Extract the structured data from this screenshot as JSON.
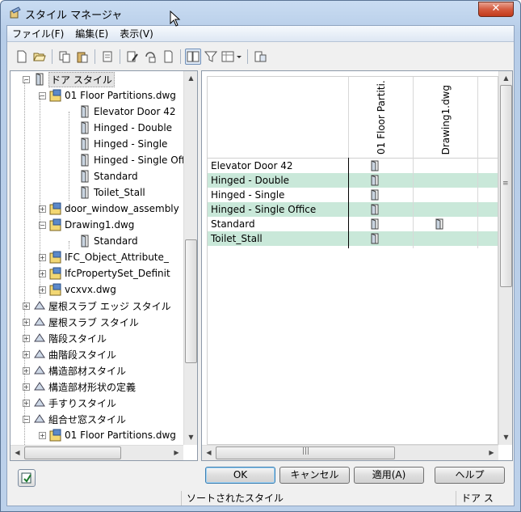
{
  "window": {
    "title": "スタイル マネージャ",
    "close_label": "✕"
  },
  "menu": [
    {
      "label": "ファイル(F)"
    },
    {
      "label": "編集(E)"
    },
    {
      "label": "表示(V)"
    }
  ],
  "toolbar": {
    "icons": [
      "new-icon",
      "open-icon",
      "copy-icon",
      "paste-icon",
      "purge-icon",
      "edit-icon",
      "set-from-icon",
      "toggle-view-icon",
      "filter-icon",
      "view-options-icon",
      "sort-icon"
    ]
  },
  "tree": {
    "rows": [
      {
        "label": "ドア スタイル",
        "level": 0,
        "expander": "−",
        "icon": "door-icon",
        "selected": true
      },
      {
        "label": "01 Floor Partitions.dwg",
        "level": 1,
        "expander": "−",
        "icon": "drawing-file-icon"
      },
      {
        "label": "Elevator Door 42",
        "level": 2,
        "icon": "door-style-icon"
      },
      {
        "label": "Hinged - Double",
        "level": 2,
        "icon": "door-style-icon"
      },
      {
        "label": "Hinged - Single",
        "level": 2,
        "icon": "door-style-icon"
      },
      {
        "label": "Hinged - Single Office",
        "level": 2,
        "icon": "door-style-icon"
      },
      {
        "label": "Standard",
        "level": 2,
        "icon": "door-style-icon"
      },
      {
        "label": "Toilet_Stall",
        "level": 2,
        "icon": "door-style-icon"
      },
      {
        "label": "door_window_assembly",
        "level": 1,
        "expander": "+",
        "icon": "drawing-file-icon"
      },
      {
        "label": "Drawing1.dwg",
        "level": 1,
        "expander": "−",
        "icon": "drawing-file-icon"
      },
      {
        "label": "Standard",
        "level": 2,
        "icon": "door-style-icon"
      },
      {
        "label": "IFC_Object_Attribute_",
        "level": 1,
        "expander": "+",
        "icon": "drawing-file-icon"
      },
      {
        "label": "IfcPropertySet_Definit",
        "level": 1,
        "expander": "+",
        "icon": "drawing-file-icon"
      },
      {
        "label": "vcxvx.dwg",
        "level": 1,
        "expander": "+",
        "icon": "drawing-file-icon"
      },
      {
        "label": "屋根スラブ エッジ スタイル",
        "level": 0,
        "expander": "+",
        "icon": "roof-edge-icon"
      },
      {
        "label": "屋根スラブ スタイル",
        "level": 0,
        "expander": "+",
        "icon": "roof-slab-icon"
      },
      {
        "label": "階段スタイル",
        "level": 0,
        "expander": "+",
        "icon": "stair-icon"
      },
      {
        "label": "曲階段スタイル",
        "level": 0,
        "expander": "+",
        "icon": "curved-stair-icon"
      },
      {
        "label": "構造部材スタイル",
        "level": 0,
        "expander": "+",
        "icon": "structural-member-icon"
      },
      {
        "label": "構造部材形状の定義",
        "level": 0,
        "expander": "+",
        "icon": "structural-shape-icon"
      },
      {
        "label": "手すりスタイル",
        "level": 0,
        "expander": "+",
        "icon": "railing-icon"
      },
      {
        "label": "組合せ窓スタイル",
        "level": 0,
        "expander": "−",
        "icon": "window-assembly-icon"
      },
      {
        "label": "01 Floor Partitions.dwg",
        "level": 1,
        "expander": "+",
        "icon": "drawing-file-icon"
      }
    ]
  },
  "grid": {
    "columns": [
      {
        "label": "01 Floor Partiti..."
      },
      {
        "label": "Drawing1.dwg"
      },
      {
        "label": ""
      }
    ],
    "rows": [
      {
        "label": "Elevator Door 42",
        "cells": [
          true,
          false,
          false
        ]
      },
      {
        "label": "Hinged - Double",
        "cells": [
          true,
          false,
          false
        ]
      },
      {
        "label": "Hinged - Single",
        "cells": [
          true,
          false,
          false
        ]
      },
      {
        "label": "Hinged - Single Office",
        "cells": [
          true,
          false,
          false
        ]
      },
      {
        "label": "Standard",
        "cells": [
          true,
          true,
          false
        ]
      },
      {
        "label": "Toilet_Stall",
        "cells": [
          true,
          false,
          false
        ]
      }
    ]
  },
  "buttons": {
    "ok": "OK",
    "cancel": "キャンセル",
    "apply": "適用(A)",
    "help": "ヘルプ"
  },
  "status": {
    "message": "ソートされたスタイル",
    "type": "ドア ス"
  },
  "colors": {
    "alt_row": "#c9e8d9",
    "title_bar": "#c9dcf2"
  }
}
